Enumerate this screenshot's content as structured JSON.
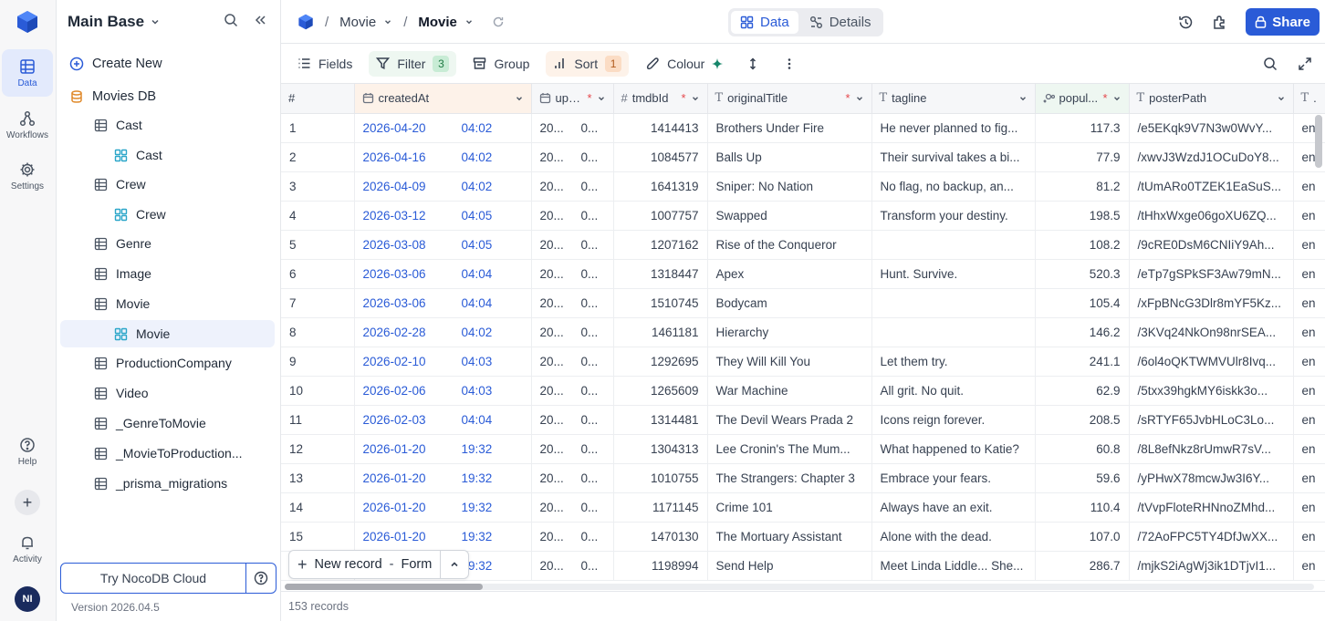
{
  "rail": {
    "items": [
      {
        "label": "Data",
        "icon": "table-icon"
      },
      {
        "label": "Workflows",
        "icon": "workflows-icon"
      },
      {
        "label": "Settings",
        "icon": "gear-icon"
      }
    ],
    "help": "Help",
    "activity": "Activity",
    "avatar": "NI"
  },
  "sidebar": {
    "base_title": "Main Base",
    "create_new": "Create New",
    "db_name": "Movies DB",
    "items": [
      {
        "label": "Cast",
        "type": "table"
      },
      {
        "label": "Cast",
        "type": "view"
      },
      {
        "label": "Crew",
        "type": "table"
      },
      {
        "label": "Crew",
        "type": "view"
      },
      {
        "label": "Genre",
        "type": "table"
      },
      {
        "label": "Image",
        "type": "table"
      },
      {
        "label": "Movie",
        "type": "table"
      },
      {
        "label": "Movie",
        "type": "view",
        "selected": true
      },
      {
        "label": "ProductionCompany",
        "type": "table"
      },
      {
        "label": "Video",
        "type": "table"
      },
      {
        "label": "_GenreToMovie",
        "type": "table"
      },
      {
        "label": "_MovieToProduction...",
        "type": "table"
      },
      {
        "label": "_prisma_migrations",
        "type": "table"
      }
    ],
    "try_cloud": "Try NocoDB Cloud",
    "version": "Version 2026.04.5"
  },
  "topbar": {
    "crumb_table": "Movie",
    "crumb_view": "Movie",
    "tab_data": "Data",
    "tab_details": "Details",
    "share": "Share"
  },
  "toolbar": {
    "fields": "Fields",
    "filter": "Filter",
    "filter_count": "3",
    "group": "Group",
    "sort": "Sort",
    "sort_count": "1",
    "colour": "Colour"
  },
  "grid": {
    "columns": [
      {
        "name": "#",
        "type": "rownum",
        "required": false
      },
      {
        "name": "createdAt",
        "type": "datetime",
        "required": false
      },
      {
        "name": "upd...",
        "type": "datetime",
        "required": true
      },
      {
        "name": "tmdbId",
        "type": "number",
        "required": true
      },
      {
        "name": "originalTitle",
        "type": "text",
        "required": true
      },
      {
        "name": "tagline",
        "type": "text",
        "required": false
      },
      {
        "name": "popul...",
        "type": "decimal",
        "required": true
      },
      {
        "name": "posterPath",
        "type": "text",
        "required": false
      },
      {
        "name": "...",
        "type": "text",
        "required": false
      }
    ],
    "rows": [
      {
        "n": "1",
        "date": "2026-04-20",
        "time": "04:02",
        "upd": "20...",
        "upd2": "0...",
        "tmdb": "1414413",
        "title": "Brothers Under Fire",
        "tagline": "He never planned to fig...",
        "pop": "117.3",
        "poster": "/e5EKqk9V7N3w0WvY...",
        "lang": "en"
      },
      {
        "n": "2",
        "date": "2026-04-16",
        "time": "04:02",
        "upd": "20...",
        "upd2": "0...",
        "tmdb": "1084577",
        "title": "Balls Up",
        "tagline": "Their survival takes a bi...",
        "pop": "77.9",
        "poster": "/xwvJ3WzdJ1OCuDoY8...",
        "lang": "en"
      },
      {
        "n": "3",
        "date": "2026-04-09",
        "time": "04:02",
        "upd": "20...",
        "upd2": "0...",
        "tmdb": "1641319",
        "title": "Sniper: No Nation",
        "tagline": "No flag, no backup, an...",
        "pop": "81.2",
        "poster": "/tUmARo0TZEK1EaSuS...",
        "lang": "en"
      },
      {
        "n": "4",
        "date": "2026-03-12",
        "time": "04:05",
        "upd": "20...",
        "upd2": "0...",
        "tmdb": "1007757",
        "title": "Swapped",
        "tagline": "Transform your destiny.",
        "pop": "198.5",
        "poster": "/tHhxWxge06goXU6ZQ...",
        "lang": "en"
      },
      {
        "n": "5",
        "date": "2026-03-08",
        "time": "04:05",
        "upd": "20...",
        "upd2": "0...",
        "tmdb": "1207162",
        "title": "Rise of the Conqueror",
        "tagline": "",
        "pop": "108.2",
        "poster": "/9cRE0DsM6CNIiY9Ah...",
        "lang": "en"
      },
      {
        "n": "6",
        "date": "2026-03-06",
        "time": "04:04",
        "upd": "20...",
        "upd2": "0...",
        "tmdb": "1318447",
        "title": "Apex",
        "tagline": "Hunt. Survive.",
        "pop": "520.3",
        "poster": "/eTp7gSPkSF3Aw79mN...",
        "lang": "en"
      },
      {
        "n": "7",
        "date": "2026-03-06",
        "time": "04:04",
        "upd": "20...",
        "upd2": "0...",
        "tmdb": "1510745",
        "title": "Bodycam",
        "tagline": "",
        "pop": "105.4",
        "poster": "/xFpBNcG3Dlr8mYF5Kz...",
        "lang": "en"
      },
      {
        "n": "8",
        "date": "2026-02-28",
        "time": "04:02",
        "upd": "20...",
        "upd2": "0...",
        "tmdb": "1461181",
        "title": "Hierarchy",
        "tagline": "",
        "pop": "146.2",
        "poster": "/3KVq24NkOn98nrSEA...",
        "lang": "en"
      },
      {
        "n": "9",
        "date": "2026-02-10",
        "time": "04:03",
        "upd": "20...",
        "upd2": "0...",
        "tmdb": "1292695",
        "title": "They Will Kill You",
        "tagline": "Let them try.",
        "pop": "241.1",
        "poster": "/6ol4oQKTWMVUlr8Ivq...",
        "lang": "en"
      },
      {
        "n": "10",
        "date": "2026-02-06",
        "time": "04:03",
        "upd": "20...",
        "upd2": "0...",
        "tmdb": "1265609",
        "title": "War Machine",
        "tagline": "All grit. No quit.",
        "pop": "62.9",
        "poster": "/5txx39hgkMY6iskk3o...",
        "lang": "en"
      },
      {
        "n": "11",
        "date": "2026-02-03",
        "time": "04:04",
        "upd": "20...",
        "upd2": "0...",
        "tmdb": "1314481",
        "title": "The Devil Wears Prada 2",
        "tagline": "Icons reign forever.",
        "pop": "208.5",
        "poster": "/sRTYF65JvbHLoC3Lo...",
        "lang": "en"
      },
      {
        "n": "12",
        "date": "2026-01-20",
        "time": "19:32",
        "upd": "20...",
        "upd2": "0...",
        "tmdb": "1304313",
        "title": "Lee Cronin's The Mum...",
        "tagline": "What happened to Katie?",
        "pop": "60.8",
        "poster": "/8L8efNkz8rUmwR7sV...",
        "lang": "en"
      },
      {
        "n": "13",
        "date": "2026-01-20",
        "time": "19:32",
        "upd": "20...",
        "upd2": "0...",
        "tmdb": "1010755",
        "title": "The Strangers: Chapter 3",
        "tagline": "Embrace your fears.",
        "pop": "59.6",
        "poster": "/yPHwX78mcwJw3I6Y...",
        "lang": "en"
      },
      {
        "n": "14",
        "date": "2026-01-20",
        "time": "19:32",
        "upd": "20...",
        "upd2": "0...",
        "tmdb": "1171145",
        "title": "Crime 101",
        "tagline": "Always have an exit.",
        "pop": "110.4",
        "poster": "/tVvpFloteRHNnoZMhd...",
        "lang": "en"
      },
      {
        "n": "15",
        "date": "2026-01-20",
        "time": "19:32",
        "upd": "20...",
        "upd2": "0...",
        "tmdb": "1470130",
        "title": "The Mortuary Assistant",
        "tagline": "Alone with the dead.",
        "pop": "107.0",
        "poster": "/72AoFPC5TY4DfJwXX...",
        "lang": "en"
      },
      {
        "n": "16",
        "date": "2026-01-20",
        "time": "19:32",
        "upd": "20...",
        "upd2": "0...",
        "tmdb": "1198994",
        "title": "Send Help",
        "tagline": "Meet Linda Liddle... She...",
        "pop": "286.7",
        "poster": "/mjkS2iAgWj3ik1DTjvI1...",
        "lang": "en"
      }
    ],
    "new_record": "New record",
    "new_record_mode": "Form",
    "record_count": "153 records"
  },
  "colors": {
    "accent": "#2a5bd7",
    "required": "#e5484d",
    "filter_bg": "#eef7f1",
    "sort_bg": "#fdf2e9"
  }
}
